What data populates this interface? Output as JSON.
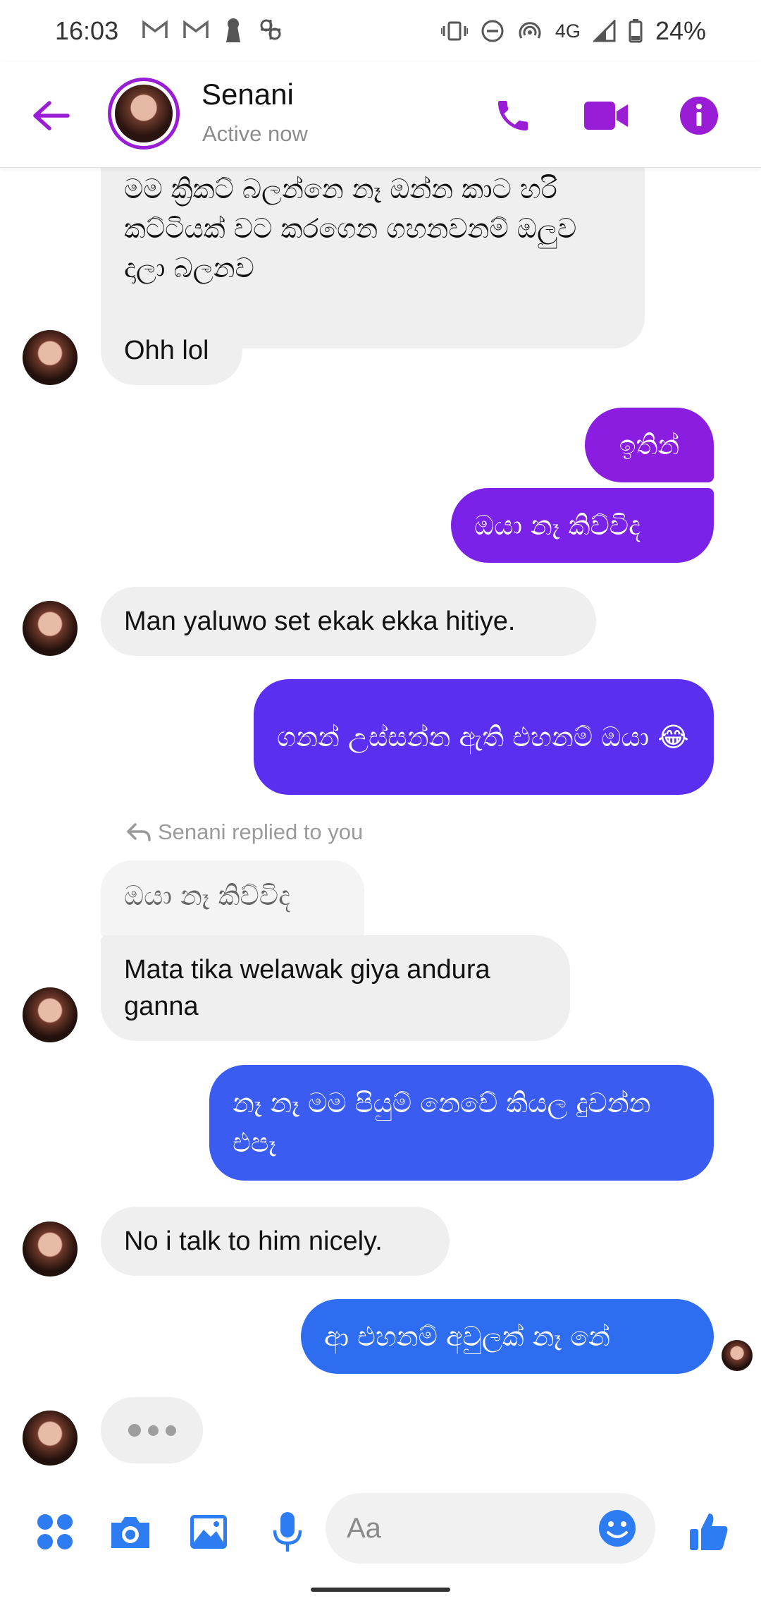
{
  "status_bar": {
    "time": "16:03",
    "network": "4G",
    "battery": "24%"
  },
  "header": {
    "name": "Senani",
    "status": "Active now"
  },
  "messages": [
    {
      "text": "මම ක්‍රිකට් බලන්නෙ නෑ  ඔන්න කාට හරි කට්ටියක් වට කරගෙන ගහනවනම් ඔලුව දාලා බලනව",
      "direction": "in"
    },
    {
      "text": "Ohh lol",
      "direction": "in"
    },
    {
      "text": "ඉතින්",
      "direction": "out"
    },
    {
      "text": "ඔයා නෑ කිව්විද",
      "direction": "out"
    },
    {
      "text": "Man yaluwo set ekak ekka hitiye.",
      "direction": "in"
    },
    {
      "text": "ගනන් උස්සන්න ඇති එහනම් ඔයා 😂",
      "direction": "out"
    },
    {
      "text": "ඔයා නෑ කිව්විද",
      "direction": "in",
      "quoted": true
    },
    {
      "text": "Mata tika welawak giya andura ganna",
      "direction": "in"
    },
    {
      "text": "නෑ නෑ මම පියුම් නෙවේ කියල දුවන්න එපෑ",
      "direction": "out"
    },
    {
      "text": "No i talk to him nicely.",
      "direction": "in"
    },
    {
      "text": "ආ එහනම් අවුලක් නෑ නේ",
      "direction": "out"
    }
  ],
  "reply_label": "Senani replied to you",
  "composer": {
    "placeholder": "Aa"
  },
  "colors": {
    "accent_purple": "#9a1dd6",
    "bubble_in": "#efefef",
    "bubble_out_1": "#8a1de0",
    "bubble_out_2": "#7a22e8",
    "bubble_out_3": "#5a2ff0",
    "bubble_out_4": "#3a5cf0",
    "bubble_out_5": "#2f6df0",
    "composer_icon": "#2d7cf2"
  },
  "icons": {
    "back": "arrow-left-icon",
    "call": "phone-icon",
    "video": "video-camera-icon",
    "info": "info-icon",
    "apps": "four-dots-icon",
    "camera": "camera-icon",
    "gallery": "image-icon",
    "mic": "microphone-icon",
    "emoji": "smiley-icon",
    "like": "thumbs-up-icon"
  }
}
